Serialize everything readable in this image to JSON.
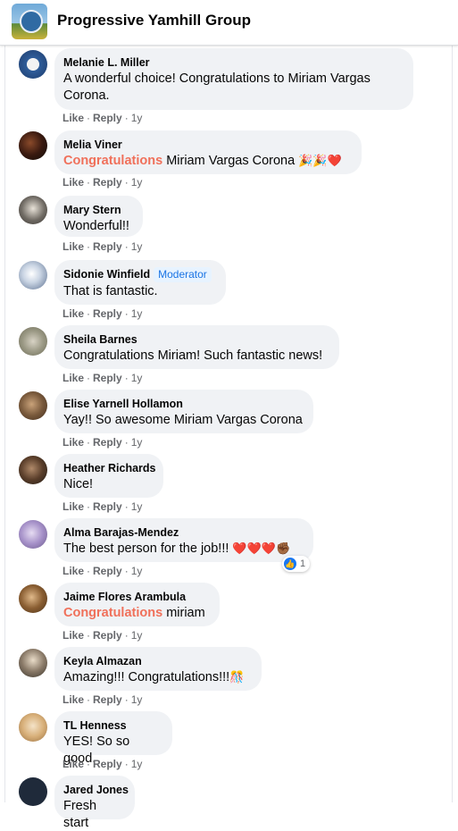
{
  "header": {
    "title": "Progressive Yamhill Group"
  },
  "actions": {
    "like": "Like",
    "reply": "Reply",
    "sep": "·"
  },
  "comments": [
    {
      "name": "Melanie L. Miller",
      "text_lines": [
        "A wonderful choice! Congratulations to Miriam Vargas",
        "Corona."
      ],
      "time": "1y"
    },
    {
      "name": "Melia Viner",
      "highlight": "Congratulations",
      "text": " Miriam Vargas Corona ",
      "emoji": "🎉🎉❤️",
      "time": "1y"
    },
    {
      "name": "Mary Stern",
      "text": "Wonderful!!",
      "time": "1y"
    },
    {
      "name": "Sidonie Winfield",
      "badge": "Moderator",
      "text": "That is fantastic.",
      "time": "1y"
    },
    {
      "name": "Sheila Barnes",
      "text": "Congratulations Miriam! Such fantastic news!",
      "time": "1y"
    },
    {
      "name": "Elise Yarnell Hollamon",
      "text": "Yay!! So awesome Miriam Vargas Corona",
      "time": "1y"
    },
    {
      "name": "Heather Richards",
      "text": "Nice!",
      "time": "1y"
    },
    {
      "name": "Alma Barajas-Mendez",
      "text": "The best person for the job!!! ",
      "emoji": "❤️❤️❤️✊🏾",
      "reaction_count": "1",
      "time": "1y"
    },
    {
      "name": "Jaime Flores Arambula",
      "highlight": "Congratulations",
      "text": " miriam",
      "time": "1y"
    },
    {
      "name": "Keyla Almazan",
      "text": "Amazing!!! Congratulations!!!",
      "emoji": "🎊",
      "time": "1y"
    },
    {
      "name": "TL Henness",
      "text": "YES! So so good.",
      "time": "1y"
    },
    {
      "name": "Jared Jones",
      "text": "Fresh start",
      "time": ""
    }
  ]
}
